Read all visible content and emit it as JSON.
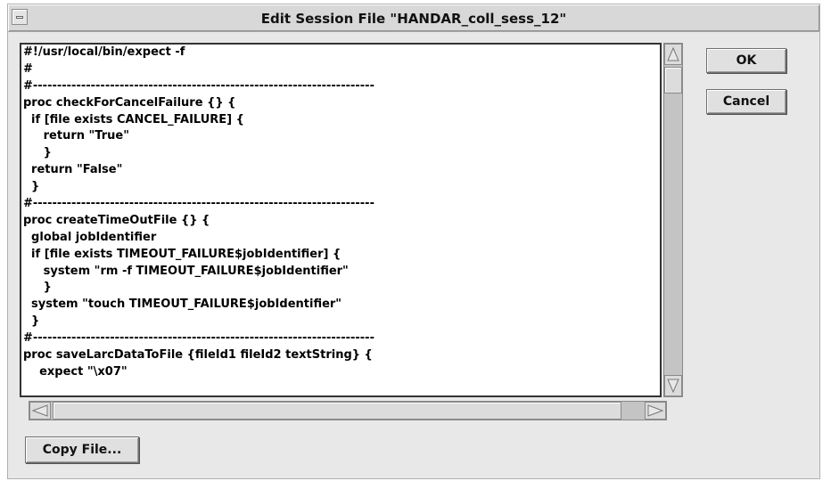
{
  "window": {
    "title": "Edit Session File \"HANDAR_coll_sess_12\""
  },
  "editor": {
    "lines": [
      "#!/usr/local/bin/expect -f",
      "#",
      "#-----------------------------------------------------------------------",
      "proc checkForCancelFailure {} {",
      "  if [file exists CANCEL_FAILURE] {",
      "     return \"True\"",
      "     }",
      "  return \"False\"",
      "  }",
      "#-----------------------------------------------------------------------",
      "proc createTimeOutFile {} {",
      "  global jobIdentifier",
      "  if [file exists TIMEOUT_FAILURE$jobIdentifier] {",
      "     system \"rm -f TIMEOUT_FAILURE$jobIdentifier\"",
      "     }",
      "  system \"touch TIMEOUT_FAILURE$jobIdentifier\"",
      "  }",
      "#-----------------------------------------------------------------------",
      "proc saveLarcDataToFile {fileId1 fileId2 textString} {",
      "    expect \"\\x07\""
    ]
  },
  "buttons": {
    "ok": "OK",
    "cancel": "Cancel",
    "copy_file": "Copy File..."
  },
  "icons": {
    "window_menu": "window-menu-icon",
    "scroll_up": "scroll-up-arrow-icon",
    "scroll_down": "scroll-down-arrow-icon",
    "scroll_left": "scroll-left-arrow-icon",
    "scroll_right": "scroll-right-arrow-icon"
  }
}
